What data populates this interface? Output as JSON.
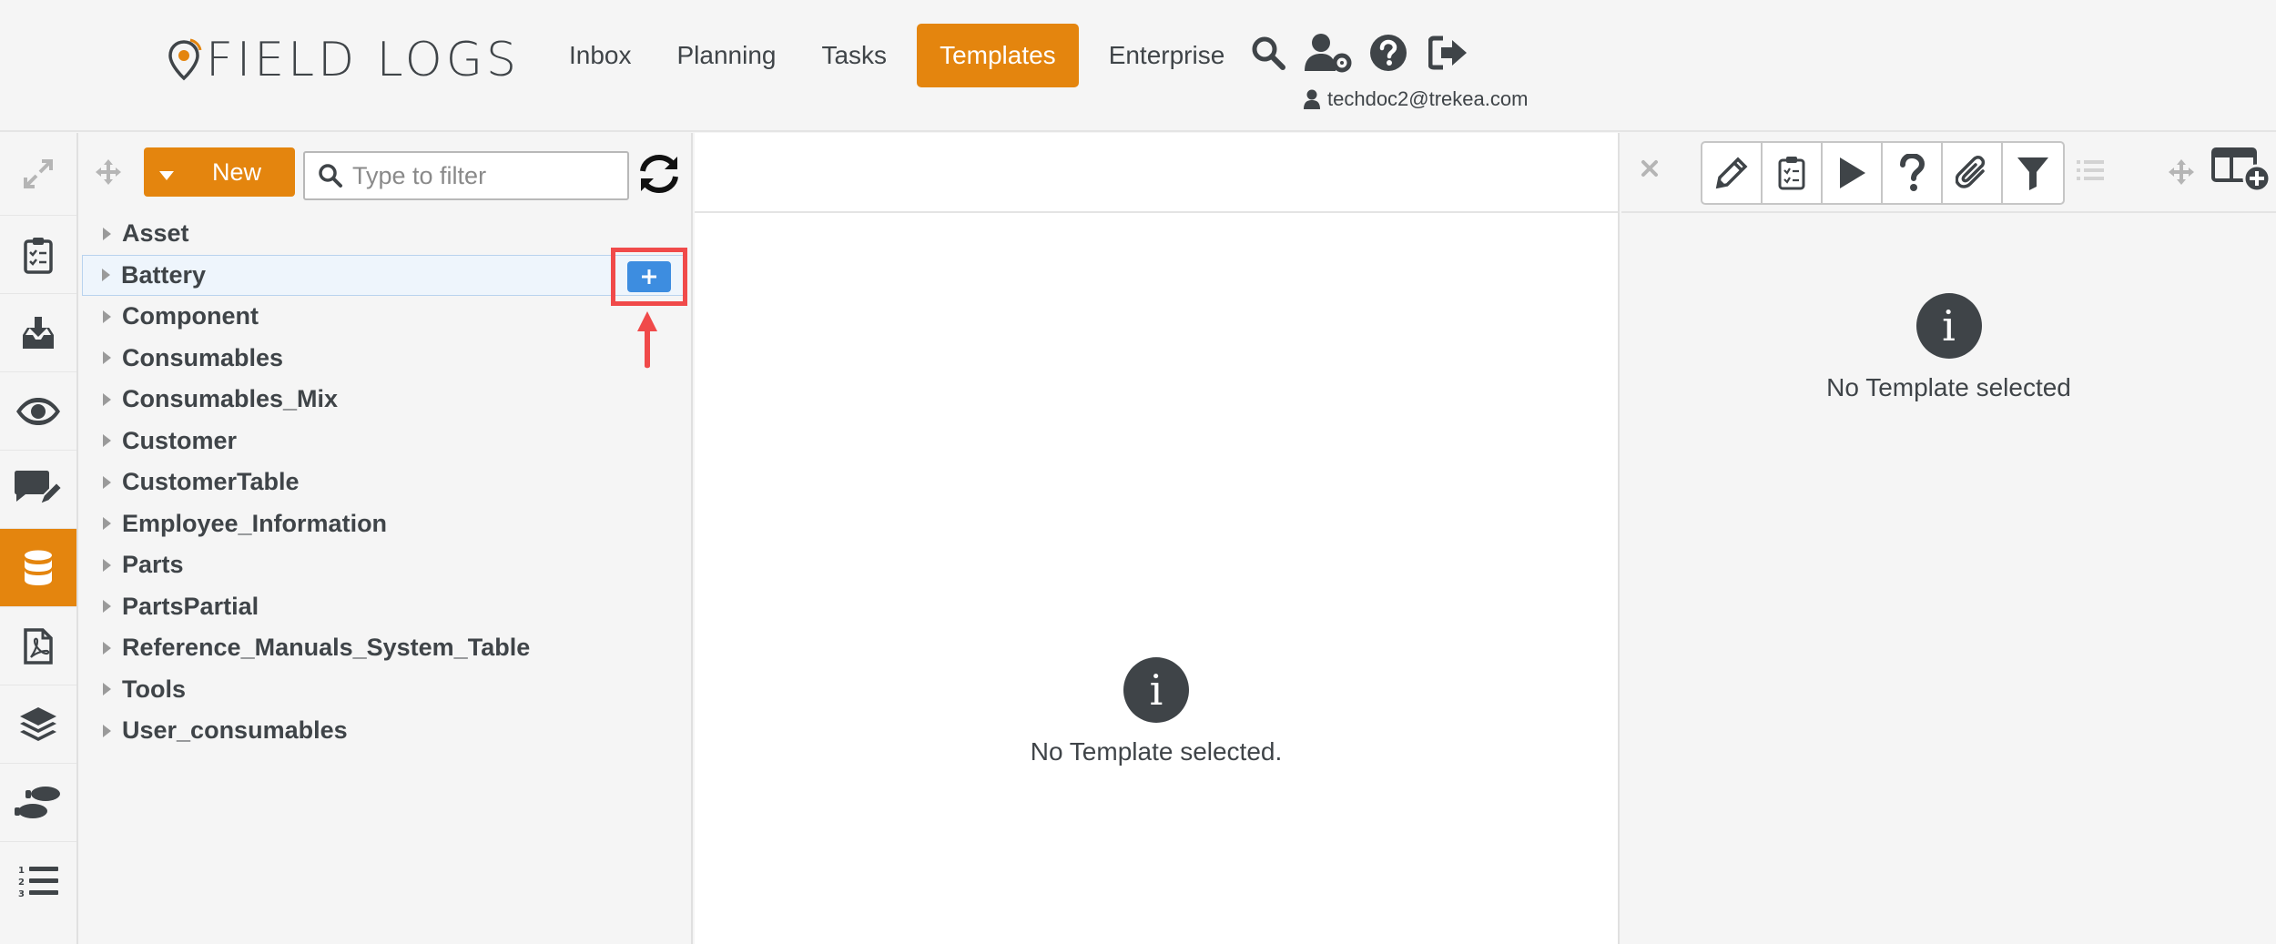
{
  "app": {
    "logo_text": "FIELD LOGS",
    "brand_color": "#e4850e",
    "nav": [
      {
        "label": "Inbox"
      },
      {
        "label": "Planning"
      },
      {
        "label": "Tasks"
      },
      {
        "label": "Templates",
        "active": true
      },
      {
        "label": "Enterprise"
      }
    ],
    "header_icons": [
      "search-icon",
      "user-settings-icon",
      "help-icon",
      "logout-icon"
    ],
    "user_email": "techdoc2@trekea.com"
  },
  "sidebar": {
    "icons": [
      "clipboard-check-icon",
      "inbox-download-icon",
      "eye-icon",
      "comments-edit-icon",
      "database-icon",
      "pdf-file-icon",
      "layers-icon",
      "footprints-icon",
      "numbered-list-icon"
    ],
    "active_index": 4
  },
  "tree": {
    "new_label": "New",
    "filter_placeholder": "Type to filter",
    "items": [
      {
        "label": "Asset"
      },
      {
        "label": "Battery",
        "selected": true
      },
      {
        "label": "Component"
      },
      {
        "label": "Consumables"
      },
      {
        "label": "Consumables_Mix"
      },
      {
        "label": "Customer"
      },
      {
        "label": "CustomerTable"
      },
      {
        "label": "Employee_Information"
      },
      {
        "label": "Parts"
      },
      {
        "label": "PartsPartial"
      },
      {
        "label": "Reference_Manuals_System_Table"
      },
      {
        "label": "Tools"
      },
      {
        "label": "User_consumables"
      }
    ],
    "add_button_symbol": "+"
  },
  "main": {
    "info_symbol": "i",
    "empty_message": "No Template selected."
  },
  "details": {
    "tools": [
      "pencil-icon",
      "clipboard-list-icon",
      "play-icon",
      "question-icon",
      "paperclip-icon",
      "filter-icon"
    ],
    "info_symbol": "i",
    "empty_message": "No Template selected"
  }
}
